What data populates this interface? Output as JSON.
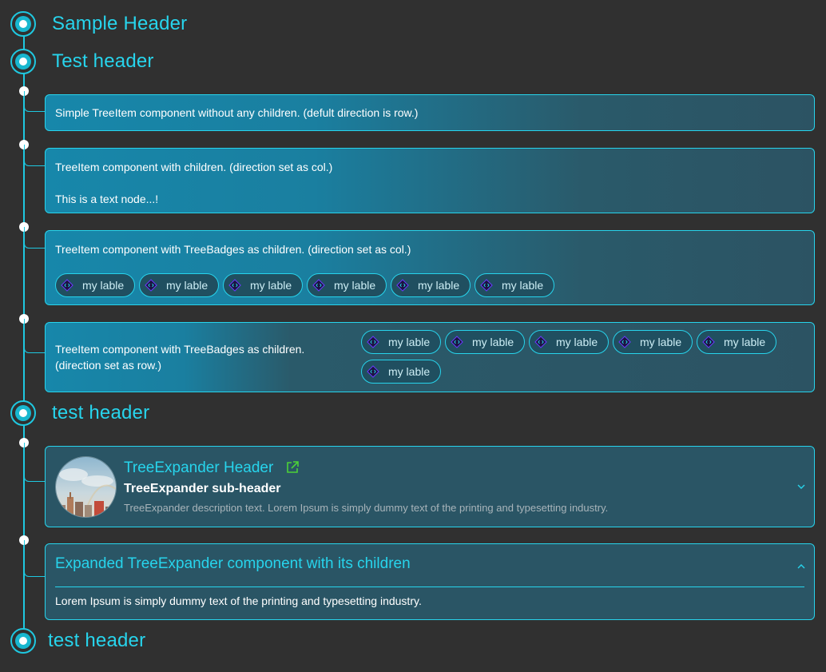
{
  "headers": [
    {
      "label": "Sample Header"
    },
    {
      "label": "Test header"
    },
    {
      "label": "test header"
    },
    {
      "label": "test header"
    }
  ],
  "item1": {
    "text": "Simple TreeItem component without any children. (defult direction is row.)"
  },
  "item2": {
    "text": "TreeItem component with children. (direction set as col.)",
    "child_text": "This is a text node...!"
  },
  "item3": {
    "text": "TreeItem component with TreeBadges as children. (direction set as col.)",
    "badges": [
      "my lable",
      "my lable",
      "my lable",
      "my lable",
      "my lable",
      "my lable"
    ]
  },
  "item4": {
    "text_line1": "TreeItem component with TreeBadges as children.",
    "text_line2": "(direction set as row.)",
    "badges": [
      "my lable",
      "my lable",
      "my lable",
      "my lable",
      "my lable",
      "my lable"
    ]
  },
  "expander": {
    "header": "TreeExpander Header",
    "sub_header": "TreeExpander sub-header",
    "description": "TreeExpander description text. Lorem Ipsum is simply dummy text of the printing and typesetting industry.",
    "link_icon": "external-link-icon",
    "toggle_icon": "chevron-down-icon",
    "expanded": false
  },
  "expanded_expander": {
    "header": "Expanded TreeExpander component with its children",
    "body": "Lorem Ipsum is simply dummy text of the printing and typesetting industry.",
    "toggle_icon": "chevron-up-icon",
    "expanded": true
  },
  "colors": {
    "background": "#303030",
    "accent": "#27d4ec",
    "card": "#2a5565",
    "link_icon": "#4cd137"
  }
}
